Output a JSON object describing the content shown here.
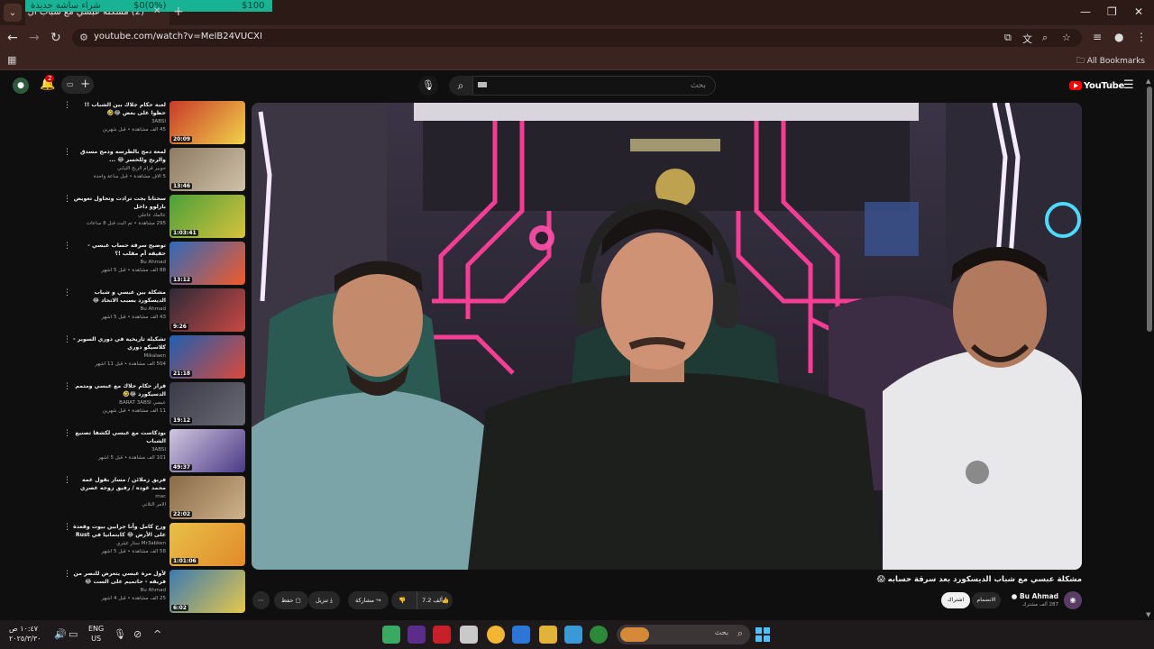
{
  "browser": {
    "tab_title": "(2) مشكلة عبسي مع شباب ال",
    "banner_left": "شراء ساشة جديدة",
    "banner_mid": "$0(0%)",
    "banner_right": "$100",
    "url": "youtube.com/watch?v=MeIB24VUCXI",
    "all_bookmarks": "All Bookmarks"
  },
  "yt": {
    "search_placeholder": "بحث",
    "logo_text": "YouTube",
    "notif_count": "2"
  },
  "recommendations": [
    {
      "title": "لعبة حكام جلاك بين الشباب !! حظوا على بعض 😂🤣",
      "channel": "3ABSI",
      "meta": "45 ألف مشاهدة • قبل شهرين",
      "duration": "20:09",
      "colors": [
        "#c83a2a",
        "#f2d24a"
      ]
    },
    {
      "title": "لمعة دمج بالطرسه ودمج مسدق والربح وللخسر 😂 ...",
      "channel": "حوبير قرام الربح الثيابي",
      "meta": "5 آلاف مشاهدة • قبل ساعة واحدة",
      "duration": "13:46",
      "colors": [
        "#8d7a64",
        "#cfc2a8"
      ]
    },
    {
      "title": "سحتانا بجت ترادت وتحاول تعويض بارلوو داخل",
      "channel": "عالمك عاجلي",
      "meta": "295 مشاهدة • تم البث قبل 8 ساعات",
      "duration": "1:03:41",
      "colors": [
        "#4aa03a",
        "#d8c23c"
      ]
    },
    {
      "title": "توضيح سرقة حساب عبسي - حقيقة أم مقلب !؟",
      "channel": "Bu Ahmad",
      "meta": "88 ألف مشاهدة • قبل 5 أشهر",
      "duration": "13:12",
      "colors": [
        "#2e6ab8",
        "#f25a2a"
      ]
    },
    {
      "title": "مشكلة بين عبسي و شباب الديسكورد بسبب الاتحاد 😂",
      "channel": "Bu Ahmad",
      "meta": "43 ألف مشاهدة • قبل 5 أشهر",
      "duration": "9:26",
      "colors": [
        "#2d2a38",
        "#c94844"
      ]
    },
    {
      "title": "تشكيلة تاريخية في دوري السوبر - كلاسيكو دوري",
      "channel": "Mikalaen",
      "meta": "504 ألف مشاهدة • قبل 11 أشهر",
      "duration": "21:18",
      "colors": [
        "#1f5fb0",
        "#d94a3a"
      ]
    },
    {
      "title": "قرار حكام جلاك مع عبسي ومتمم الدسيكورد 😂🤣",
      "channel": "عبسي BARAT 3ABSI",
      "meta": "11 ألف مشاهدة • قبل شهرين",
      "duration": "19:12",
      "colors": [
        "#3a3a48",
        "#6a6a76"
      ]
    },
    {
      "title": "بودكاست مع عبسي لكشفا تصنيع الشباب",
      "channel": "3ABSI",
      "meta": "101 ألف مشاهدة • قبل 5 أشهر",
      "duration": "49:37",
      "colors": [
        "#d2c7e0",
        "#4a3a86"
      ]
    },
    {
      "title": "فريق زملائن / مسار بقول عمه محمد غوده / رفيق زوجه عصري وأكرام 310",
      "channel": "mac",
      "meta": "الأمر التلاني",
      "duration": "22:02",
      "colors": [
        "#8a6a48",
        "#cdb38a"
      ]
    },
    {
      "title": "ورح كامل وأنا جرابين بيوت وقعدة على الأرض 😂 كابتمانيا في Rust",
      "channel": "Mr3abken ستار غيثري",
      "meta": "58 ألف مشاهدة • قبل 5 أشهر",
      "duration": "1:01:06",
      "colors": [
        "#e8c048",
        "#e28a2a"
      ]
    },
    {
      "title": "لأول مرة عبسي يتعرض للنصر من فريقه - حاتميم على الست 😂",
      "channel": "Bu Ahmad",
      "meta": "25 ألف مشاهدة • قبل 4 أشهر",
      "duration": "6:02",
      "colors": [
        "#3d7ab0",
        "#e5c84a"
      ]
    }
  ],
  "video": {
    "title": "مشكلة عبسي مع شباب الديسكورد بعد سرقة حسابه 😱",
    "channel": "Bu Ahmad",
    "subs": "287 ألف مشترك",
    "join": "الانضمام",
    "subscribe": "اشتراك",
    "likes": "7.2 ألف",
    "share": "مشاركة",
    "download": "تنزيل",
    "save": "حفظ",
    "more": "⋯"
  },
  "taskbar": {
    "time": "١٠:٤٧ ص",
    "date": "٢٠٢٥/٣/٣٠",
    "lang1": "ENG",
    "lang2": "US",
    "search_text": "بحث"
  }
}
